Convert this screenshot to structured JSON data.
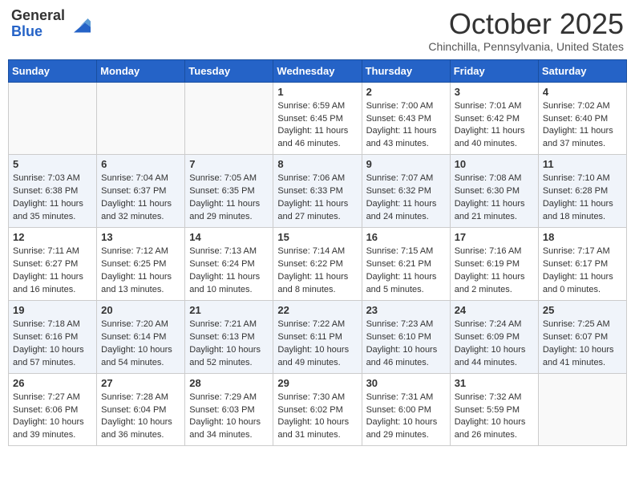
{
  "header": {
    "logo_general": "General",
    "logo_blue": "Blue",
    "month": "October 2025",
    "location": "Chinchilla, Pennsylvania, United States"
  },
  "weekdays": [
    "Sunday",
    "Monday",
    "Tuesday",
    "Wednesday",
    "Thursday",
    "Friday",
    "Saturday"
  ],
  "weeks": [
    [
      {
        "day": "",
        "info": ""
      },
      {
        "day": "",
        "info": ""
      },
      {
        "day": "",
        "info": ""
      },
      {
        "day": "1",
        "info": "Sunrise: 6:59 AM\nSunset: 6:45 PM\nDaylight: 11 hours\nand 46 minutes."
      },
      {
        "day": "2",
        "info": "Sunrise: 7:00 AM\nSunset: 6:43 PM\nDaylight: 11 hours\nand 43 minutes."
      },
      {
        "day": "3",
        "info": "Sunrise: 7:01 AM\nSunset: 6:42 PM\nDaylight: 11 hours\nand 40 minutes."
      },
      {
        "day": "4",
        "info": "Sunrise: 7:02 AM\nSunset: 6:40 PM\nDaylight: 11 hours\nand 37 minutes."
      }
    ],
    [
      {
        "day": "5",
        "info": "Sunrise: 7:03 AM\nSunset: 6:38 PM\nDaylight: 11 hours\nand 35 minutes."
      },
      {
        "day": "6",
        "info": "Sunrise: 7:04 AM\nSunset: 6:37 PM\nDaylight: 11 hours\nand 32 minutes."
      },
      {
        "day": "7",
        "info": "Sunrise: 7:05 AM\nSunset: 6:35 PM\nDaylight: 11 hours\nand 29 minutes."
      },
      {
        "day": "8",
        "info": "Sunrise: 7:06 AM\nSunset: 6:33 PM\nDaylight: 11 hours\nand 27 minutes."
      },
      {
        "day": "9",
        "info": "Sunrise: 7:07 AM\nSunset: 6:32 PM\nDaylight: 11 hours\nand 24 minutes."
      },
      {
        "day": "10",
        "info": "Sunrise: 7:08 AM\nSunset: 6:30 PM\nDaylight: 11 hours\nand 21 minutes."
      },
      {
        "day": "11",
        "info": "Sunrise: 7:10 AM\nSunset: 6:28 PM\nDaylight: 11 hours\nand 18 minutes."
      }
    ],
    [
      {
        "day": "12",
        "info": "Sunrise: 7:11 AM\nSunset: 6:27 PM\nDaylight: 11 hours\nand 16 minutes."
      },
      {
        "day": "13",
        "info": "Sunrise: 7:12 AM\nSunset: 6:25 PM\nDaylight: 11 hours\nand 13 minutes."
      },
      {
        "day": "14",
        "info": "Sunrise: 7:13 AM\nSunset: 6:24 PM\nDaylight: 11 hours\nand 10 minutes."
      },
      {
        "day": "15",
        "info": "Sunrise: 7:14 AM\nSunset: 6:22 PM\nDaylight: 11 hours\nand 8 minutes."
      },
      {
        "day": "16",
        "info": "Sunrise: 7:15 AM\nSunset: 6:21 PM\nDaylight: 11 hours\nand 5 minutes."
      },
      {
        "day": "17",
        "info": "Sunrise: 7:16 AM\nSunset: 6:19 PM\nDaylight: 11 hours\nand 2 minutes."
      },
      {
        "day": "18",
        "info": "Sunrise: 7:17 AM\nSunset: 6:17 PM\nDaylight: 11 hours\nand 0 minutes."
      }
    ],
    [
      {
        "day": "19",
        "info": "Sunrise: 7:18 AM\nSunset: 6:16 PM\nDaylight: 10 hours\nand 57 minutes."
      },
      {
        "day": "20",
        "info": "Sunrise: 7:20 AM\nSunset: 6:14 PM\nDaylight: 10 hours\nand 54 minutes."
      },
      {
        "day": "21",
        "info": "Sunrise: 7:21 AM\nSunset: 6:13 PM\nDaylight: 10 hours\nand 52 minutes."
      },
      {
        "day": "22",
        "info": "Sunrise: 7:22 AM\nSunset: 6:11 PM\nDaylight: 10 hours\nand 49 minutes."
      },
      {
        "day": "23",
        "info": "Sunrise: 7:23 AM\nSunset: 6:10 PM\nDaylight: 10 hours\nand 46 minutes."
      },
      {
        "day": "24",
        "info": "Sunrise: 7:24 AM\nSunset: 6:09 PM\nDaylight: 10 hours\nand 44 minutes."
      },
      {
        "day": "25",
        "info": "Sunrise: 7:25 AM\nSunset: 6:07 PM\nDaylight: 10 hours\nand 41 minutes."
      }
    ],
    [
      {
        "day": "26",
        "info": "Sunrise: 7:27 AM\nSunset: 6:06 PM\nDaylight: 10 hours\nand 39 minutes."
      },
      {
        "day": "27",
        "info": "Sunrise: 7:28 AM\nSunset: 6:04 PM\nDaylight: 10 hours\nand 36 minutes."
      },
      {
        "day": "28",
        "info": "Sunrise: 7:29 AM\nSunset: 6:03 PM\nDaylight: 10 hours\nand 34 minutes."
      },
      {
        "day": "29",
        "info": "Sunrise: 7:30 AM\nSunset: 6:02 PM\nDaylight: 10 hours\nand 31 minutes."
      },
      {
        "day": "30",
        "info": "Sunrise: 7:31 AM\nSunset: 6:00 PM\nDaylight: 10 hours\nand 29 minutes."
      },
      {
        "day": "31",
        "info": "Sunrise: 7:32 AM\nSunset: 5:59 PM\nDaylight: 10 hours\nand 26 minutes."
      },
      {
        "day": "",
        "info": ""
      }
    ]
  ]
}
